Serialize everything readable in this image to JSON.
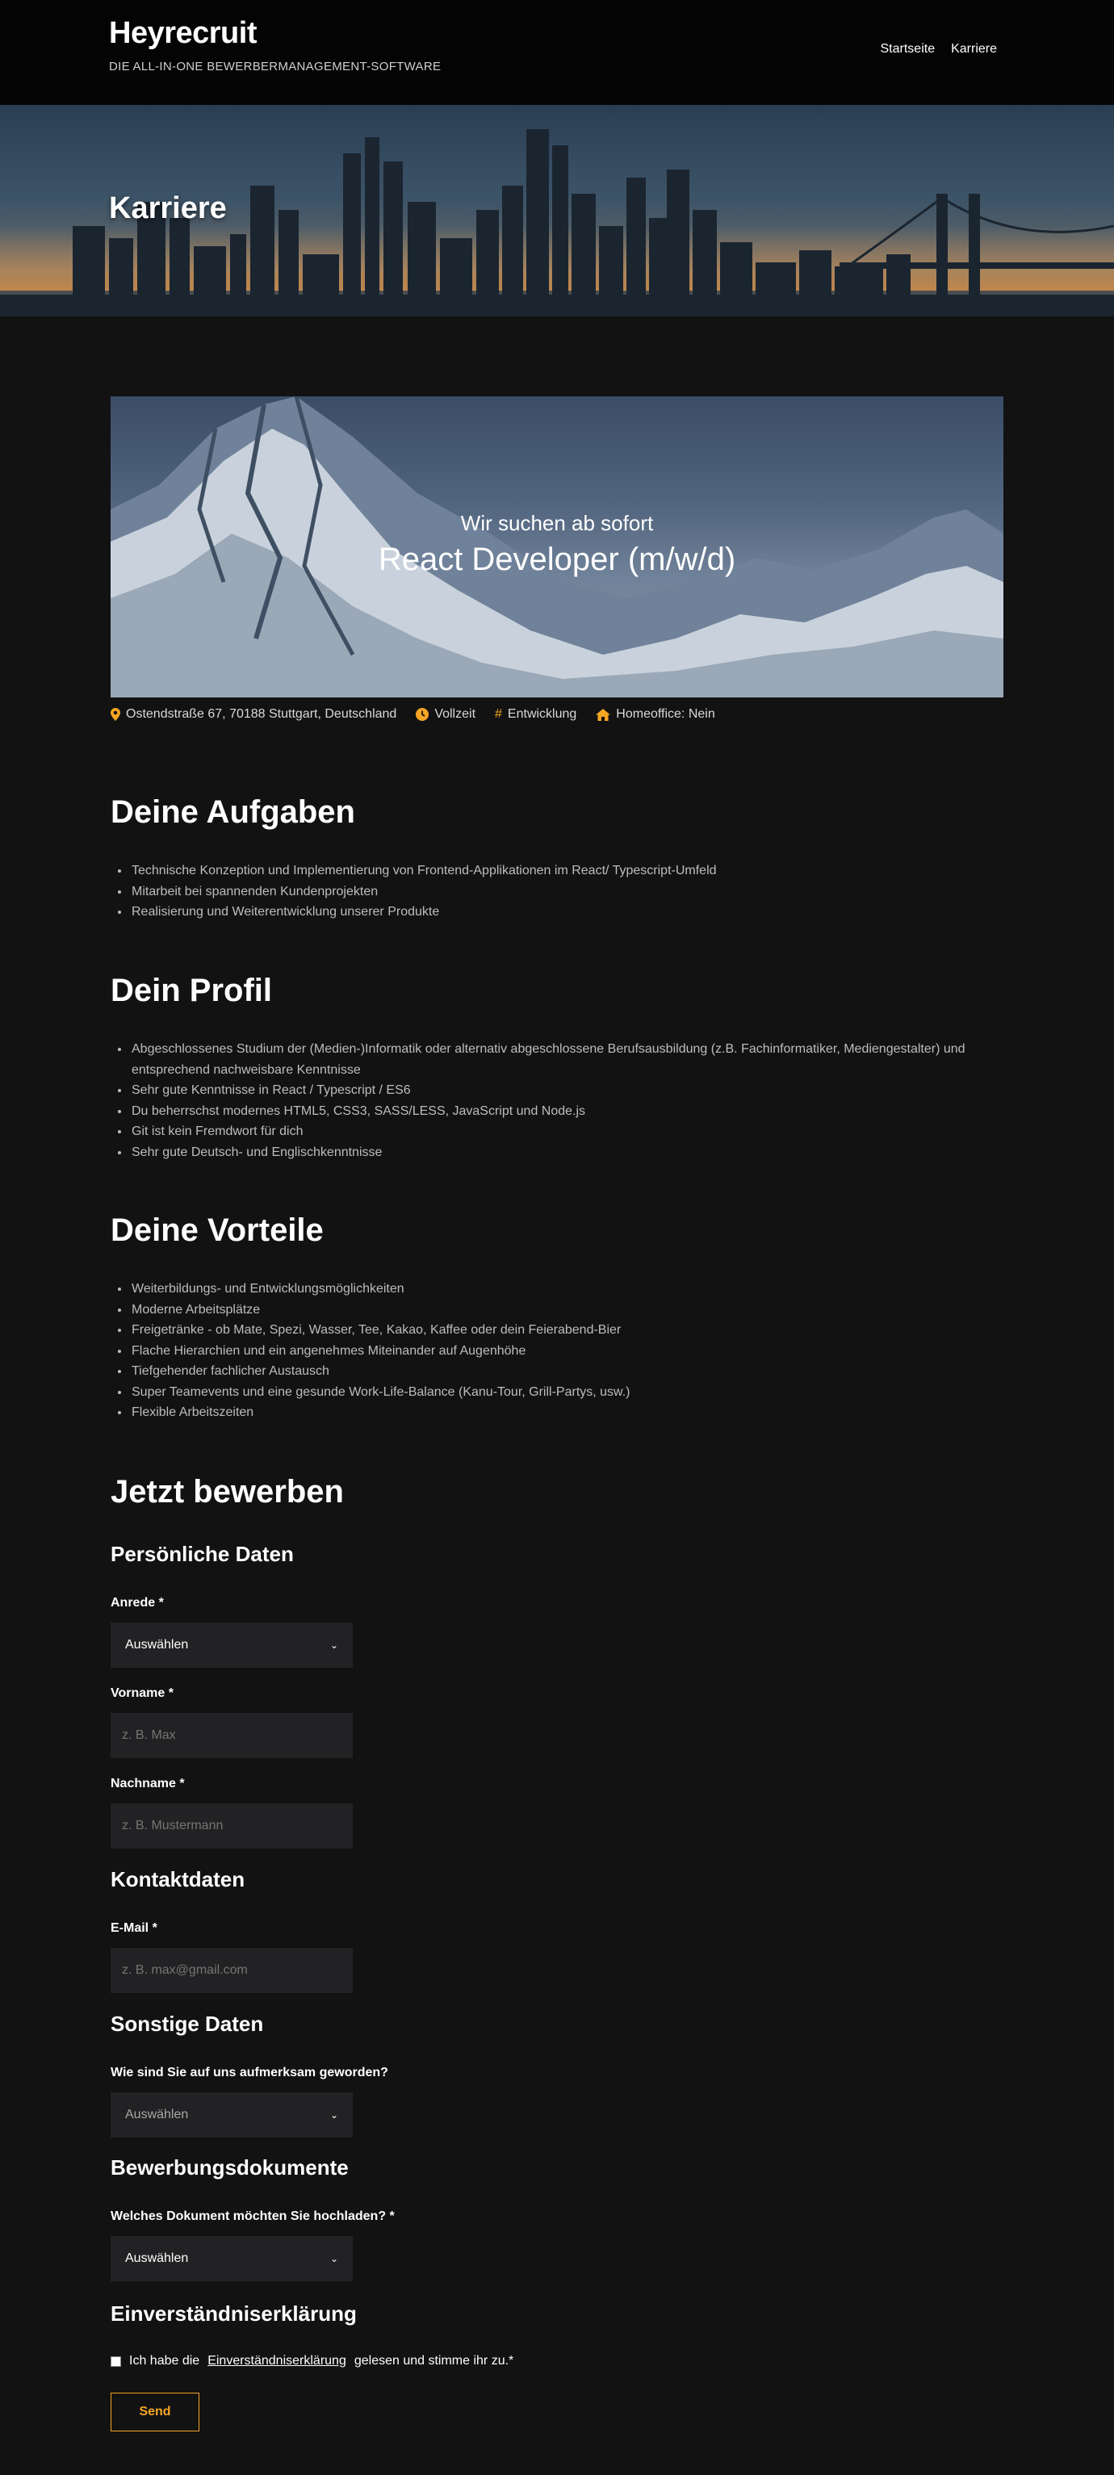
{
  "header": {
    "brand": "Heyrecruit",
    "tagline": "DIE ALL-IN-ONE BEWERBERMANAGEMENT-SOFTWARE",
    "nav": [
      "Startseite",
      "Karriere"
    ]
  },
  "hero": {
    "title": "Karriere"
  },
  "banner": {
    "subtitle": "Wir suchen ab sofort",
    "title": "React Developer (m/w/d)"
  },
  "meta": {
    "location": "Ostendstraße 67, 70188 Stuttgart, Deutschland",
    "employment": "Vollzeit",
    "department": "Entwicklung",
    "homeoffice": "Homeoffice: Nein",
    "icons": [
      "map-pin-icon",
      "clock-icon",
      "hash-icon",
      "home-icon"
    ],
    "icon_color": "#f5a623"
  },
  "sections": {
    "aufgaben": {
      "title": "Deine Aufgaben",
      "items": [
        "Technische Konzeption und Implementierung von Frontend-Applikationen im React/ Typescript-Umfeld",
        "Mitarbeit bei spannenden Kundenprojekten",
        "Realisierung und Weiterentwicklung unserer Produkte"
      ]
    },
    "profil": {
      "title": "Dein Profil",
      "items": [
        "Abgeschlossenes Studium der (Medien-)Informatik oder alternativ abgeschlossene Berufsausbildung (z.B. Fachinformatiker, Mediengestalter) und entsprechend nachweisbare Kenntnisse",
        "Sehr gute Kenntnisse in React / Typescript / ES6",
        "Du beherrschst modernes HTML5, CSS3, SASS/LESS, JavaScript und Node.js",
        "Git ist kein Fremdwort für dich",
        "Sehr gute Deutsch- und Englischkenntnisse"
      ]
    },
    "vorteile": {
      "title": "Deine Vorteile",
      "items": [
        "Weiterbildungs- und Entwicklungsmöglichkeiten",
        "Moderne Arbeitsplätze",
        "Freigetränke - ob Mate, Spezi, Wasser, Tee, Kakao, Kaffee oder dein Feierabend-Bier",
        "Flache Hierarchien und ein angenehmes Miteinander auf Augenhöhe",
        "Tiefgehender fachlicher Austausch",
        "Super Teamevents und eine gesunde Work-Life-Balance (Kanu-Tour, Grill-Partys, usw.)",
        "Flexible Arbeitszeiten"
      ]
    }
  },
  "form": {
    "title": "Jetzt bewerben",
    "personal": {
      "heading": "Persönliche Daten",
      "anrede_label": "Anrede *",
      "anrede_value": "Auswählen",
      "vorname_label": "Vorname *",
      "vorname_placeholder": "z. B. Max",
      "nachname_label": "Nachname *",
      "nachname_placeholder": "z. B. Mustermann"
    },
    "contact": {
      "heading": "Kontaktdaten",
      "email_label": "E-Mail *",
      "email_placeholder": "z. B. max@gmail.com"
    },
    "other": {
      "heading": "Sonstige Daten",
      "source_label": "Wie sind Sie auf uns aufmerksam geworden?",
      "source_value": "Auswählen"
    },
    "documents": {
      "heading": "Bewerbungsdokumente",
      "doc_label": "Welches Dokument möchten Sie hochladen? *",
      "doc_value": "Auswählen"
    },
    "consent": {
      "heading": "Einverständniserklärung",
      "prefix": "Ich habe die",
      "link": "Einverständniserklärung",
      "suffix": "gelesen und stimme ihr zu.*"
    },
    "send_label": "Send"
  },
  "colors": {
    "accent": "#f5a623",
    "background": "#121212",
    "header": "#040404",
    "field": "#222224"
  }
}
